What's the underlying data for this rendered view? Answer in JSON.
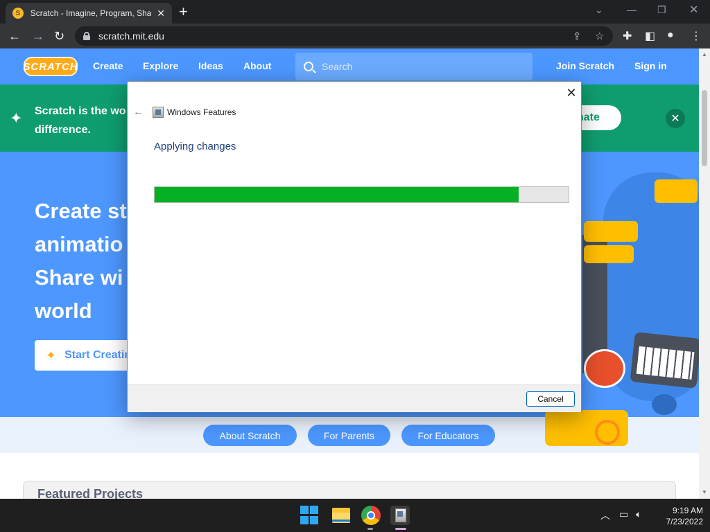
{
  "browser": {
    "tab_title": "Scratch - Imagine, Program, Share",
    "tab_close": "✕",
    "new_tab": "+",
    "url": "scratch.mit.edu"
  },
  "scratch": {
    "logo": "SCRATCH",
    "nav": {
      "create": "Create",
      "explore": "Explore",
      "ideas": "Ideas",
      "about": "About",
      "search_placeholder": "Search",
      "join": "Join Scratch",
      "signin": "Sign in"
    },
    "banner": {
      "text": "Scratch is the wo difference.",
      "donate": "nate"
    },
    "hero": {
      "line1": "Create st",
      "line2": "animatio",
      "line3": "Share wi",
      "line4": "world",
      "start_button": "Start Creatin"
    },
    "shortcuts": [
      "About Scratch",
      "For Parents",
      "For Educators"
    ],
    "featured_title": "Featured Projects"
  },
  "dialog": {
    "title": "Windows Features",
    "status": "Applying changes",
    "progress_percent": 88,
    "cancel": "Cancel"
  },
  "taskbar": {
    "time": "9:19 AM",
    "date": "7/23/2022"
  },
  "colors": {
    "scratch_blue": "#4c97ff",
    "banner_green": "#0f9d6f",
    "progress_green": "#06b025",
    "block_yellow": "#ffbf00"
  }
}
